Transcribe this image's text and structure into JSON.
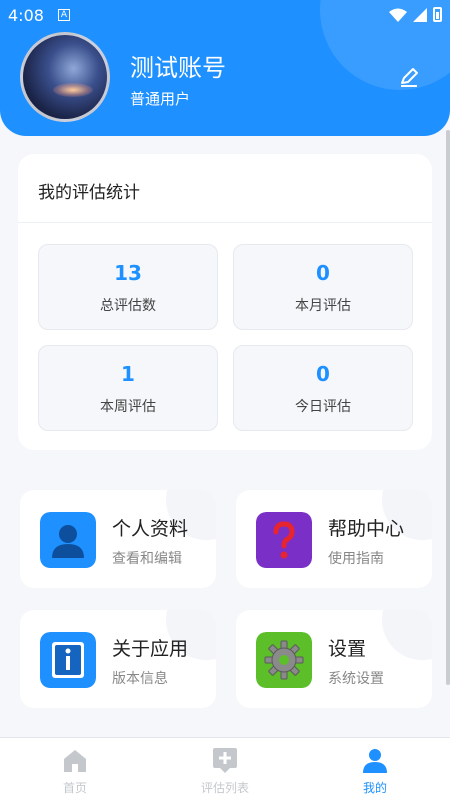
{
  "status_bar": {
    "time": "4:08",
    "notification_icon": "a-icon"
  },
  "profile": {
    "name": "测试账号",
    "role": "普通用户",
    "edit_icon": "edit-icon"
  },
  "stats": {
    "title": "我的评估统计",
    "items": [
      {
        "value": "13",
        "label": "总评估数"
      },
      {
        "value": "0",
        "label": "本月评估"
      },
      {
        "value": "1",
        "label": "本周评估"
      },
      {
        "value": "0",
        "label": "今日评估"
      }
    ]
  },
  "menu": [
    {
      "title": "个人资料",
      "subtitle": "查看和编辑",
      "icon": "person-icon",
      "color": "#1e90ff"
    },
    {
      "title": "帮助中心",
      "subtitle": "使用指南",
      "icon": "question-icon",
      "color": "#7a2fc7"
    },
    {
      "title": "关于应用",
      "subtitle": "版本信息",
      "icon": "info-icon",
      "color": "#1e90ff"
    },
    {
      "title": "设置",
      "subtitle": "系统设置",
      "icon": "gear-icon",
      "color": "#5cbf2a"
    }
  ],
  "tabs": [
    {
      "label": "首页",
      "icon": "home-icon",
      "active": false
    },
    {
      "label": "评估列表",
      "icon": "add-list-icon",
      "active": false
    },
    {
      "label": "我的",
      "icon": "user-icon",
      "active": true
    }
  ],
  "colors": {
    "primary": "#1e90ff",
    "background": "#f5f7fa",
    "inactive_tab": "#c4c7cc"
  }
}
